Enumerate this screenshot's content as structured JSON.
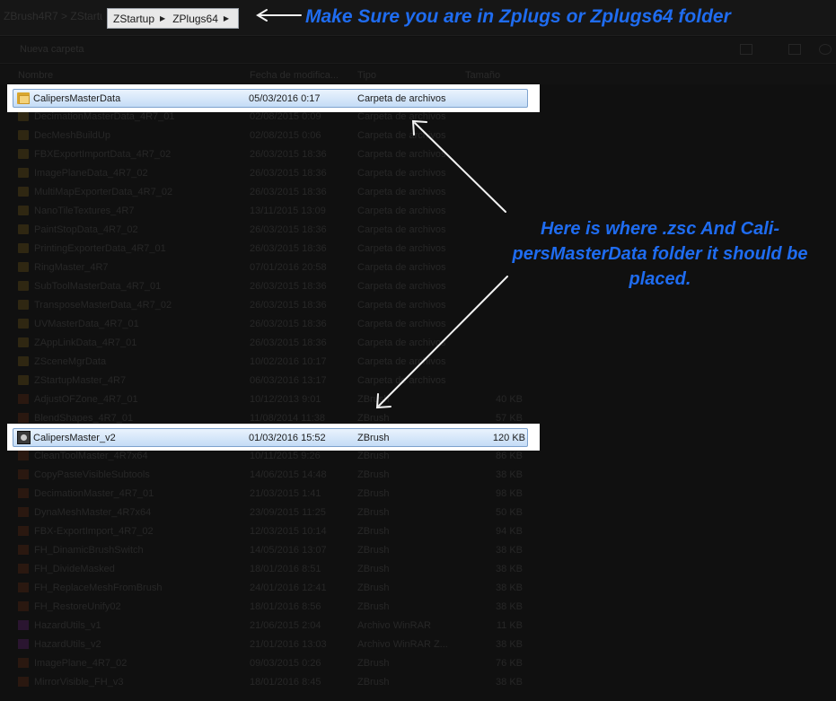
{
  "address_bar": {
    "ghost_path": "ZBrush4R7 > ZStartup > ZPlugs64",
    "breadcrumbs": [
      "ZStartup",
      "ZPlugs64"
    ]
  },
  "toolbar": {
    "new_folder_label": "Nueva carpeta"
  },
  "columns": {
    "name": "Nombre",
    "date": "Fecha de modifica...",
    "type": "Tipo",
    "size": "Tamaño"
  },
  "highlight_folder": {
    "name": "CalipersMasterData",
    "date": "05/03/2016 0:17",
    "type": "Carpeta de archivos",
    "icon": "folder-icon"
  },
  "highlight_file": {
    "name": "CalipersMaster_v2",
    "date": "01/03/2016 15:52",
    "type": "ZBrush",
    "size": "120 KB",
    "icon": "zbrush-file-icon"
  },
  "ghost_folders": [
    {
      "name": "DecimationMasterData_4R7_01",
      "date": "02/08/2015 0:09",
      "type": "Carpeta de archivos"
    },
    {
      "name": "DecMeshBuildUp",
      "date": "02/08/2015 0:06",
      "type": "Carpeta de archivos"
    },
    {
      "name": "FBXExportImportData_4R7_02",
      "date": "26/03/2015 18:36",
      "type": "Carpeta de archivos"
    },
    {
      "name": "ImagePlaneData_4R7_02",
      "date": "26/03/2015 18:36",
      "type": "Carpeta de archivos"
    },
    {
      "name": "MultiMapExporterData_4R7_02",
      "date": "26/03/2015 18:36",
      "type": "Carpeta de archivos"
    },
    {
      "name": "NanoTileTextures_4R7",
      "date": "13/11/2015 13:09",
      "type": "Carpeta de archivos"
    },
    {
      "name": "PaintStopData_4R7_02",
      "date": "26/03/2015 18:36",
      "type": "Carpeta de archivos"
    },
    {
      "name": "PrintingExporterData_4R7_01",
      "date": "26/03/2015 18:36",
      "type": "Carpeta de archivos"
    },
    {
      "name": "RingMaster_4R7",
      "date": "07/01/2016 20:58",
      "type": "Carpeta de archivos"
    },
    {
      "name": "SubToolMasterData_4R7_01",
      "date": "26/03/2015 18:36",
      "type": "Carpeta de archivos"
    },
    {
      "name": "TransposeMasterData_4R7_02",
      "date": "26/03/2015 18:36",
      "type": "Carpeta de archivos"
    },
    {
      "name": "UVMasterData_4R7_01",
      "date": "26/03/2015 18:36",
      "type": "Carpeta de archivos"
    },
    {
      "name": "ZAppLinkData_4R7_01",
      "date": "26/03/2015 18:36",
      "type": "Carpeta de archivos"
    },
    {
      "name": "ZSceneMgrData",
      "date": "10/02/2016 10:17",
      "type": "Carpeta de archivos"
    },
    {
      "name": "ZStartupMaster_4R7",
      "date": "06/03/2016 13:17",
      "type": "Carpeta de archivos"
    }
  ],
  "ghost_files_above": [
    {
      "name": "AdjustOFZone_4R7_01",
      "date": "10/12/2013 9:01",
      "type": "ZBrush",
      "size": "40 KB"
    },
    {
      "name": "BlendShapes_4R7_01",
      "date": "11/08/2014 11:38",
      "type": "ZBrush",
      "size": "57 KB"
    }
  ],
  "ghost_files_below": [
    {
      "name": "CleanToolMaster_4R7x64",
      "date": "10/11/2015 9:26",
      "type": "ZBrush",
      "size": "86 KB",
      "kind": "zbr"
    },
    {
      "name": "CopyPasteVisibleSubtools",
      "date": "14/06/2015 14:48",
      "type": "ZBrush",
      "size": "38 KB",
      "kind": "zbr"
    },
    {
      "name": "DecimationMaster_4R7_01",
      "date": "21/03/2015 1:41",
      "type": "ZBrush",
      "size": "98 KB",
      "kind": "zbr"
    },
    {
      "name": "DynaMeshMaster_4R7x64",
      "date": "23/09/2015 11:25",
      "type": "ZBrush",
      "size": "50 KB",
      "kind": "zbr"
    },
    {
      "name": "FBX-ExportImport_4R7_02",
      "date": "12/03/2015 10:14",
      "type": "ZBrush",
      "size": "94 KB",
      "kind": "zbr"
    },
    {
      "name": "FH_DinamicBrushSwitch",
      "date": "14/05/2016 13:07",
      "type": "ZBrush",
      "size": "38 KB",
      "kind": "zbr"
    },
    {
      "name": "FH_DivideMasked",
      "date": "18/01/2016 8:51",
      "type": "ZBrush",
      "size": "38 KB",
      "kind": "zbr"
    },
    {
      "name": "FH_ReplaceMeshFromBrush",
      "date": "24/01/2016 12:41",
      "type": "ZBrush",
      "size": "38 KB",
      "kind": "zbr"
    },
    {
      "name": "FH_RestoreUnify02",
      "date": "18/01/2016 8:56",
      "type": "ZBrush",
      "size": "38 KB",
      "kind": "zbr"
    },
    {
      "name": "HazardUtils_v1",
      "date": "21/06/2015 2:04",
      "type": "Archivo WinRAR",
      "size": "11 KB",
      "kind": "rar"
    },
    {
      "name": "HazardUtils_v2",
      "date": "21/01/2016 13:03",
      "type": "Archivo WinRAR Z...",
      "size": "38 KB",
      "kind": "rar"
    },
    {
      "name": "ImagePlane_4R7_02",
      "date": "09/03/2015 0:26",
      "type": "ZBrush",
      "size": "76 KB",
      "kind": "zbr"
    },
    {
      "name": "MirrorVisible_FH_v3",
      "date": "18/01/2016 8:45",
      "type": "ZBrush",
      "size": "38 KB",
      "kind": "zbr"
    }
  ],
  "annotations": {
    "top": "Make Sure you are in Zplugs or Zplugs64 folder",
    "middle": "Here is where .zsc And Cali-persMasterData folder it should be placed."
  },
  "colors": {
    "annotation": "#1f6cf0",
    "highlight": "#c4dcf6",
    "arrow": "#f2f2f2"
  }
}
